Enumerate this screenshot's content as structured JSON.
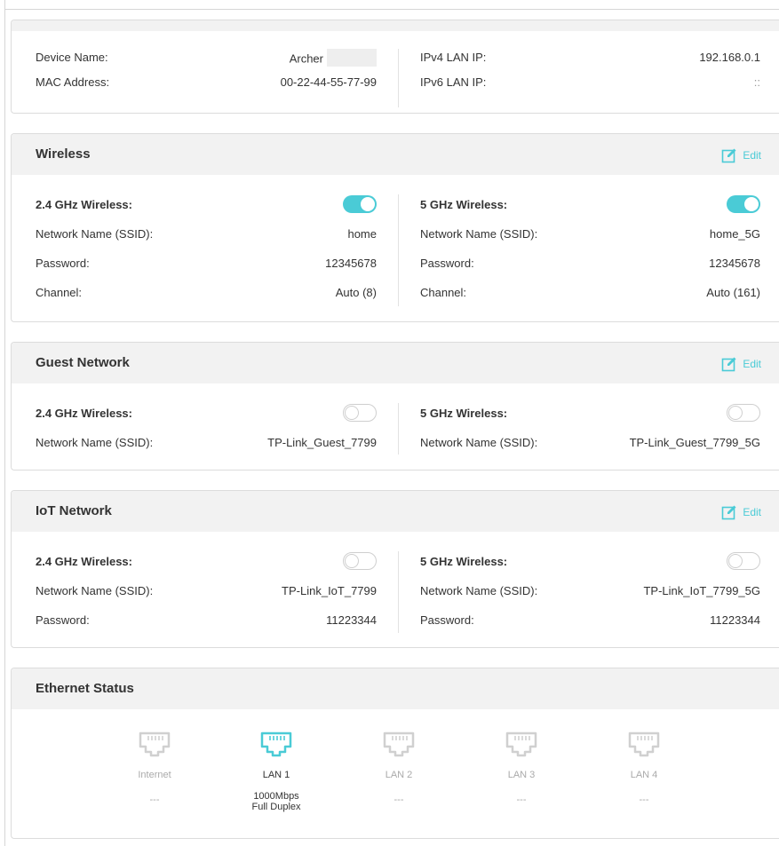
{
  "device": {
    "device_name_label": "Device Name:",
    "device_name_value": "Archer",
    "mac_label": "MAC Address:",
    "mac_value": "00-22-44-55-77-99",
    "ipv4_label": "IPv4 LAN IP:",
    "ipv4_value": "192.168.0.1",
    "ipv6_label": "IPv6 LAN IP:",
    "ipv6_value": "::"
  },
  "edit_label": "Edit",
  "wireless": {
    "title": "Wireless",
    "left": {
      "band_label": "2.4 GHz Wireless:",
      "enabled": true,
      "ssid_label": "Network Name (SSID):",
      "ssid_value": "home",
      "password_label": "Password:",
      "password_value": "12345678",
      "channel_label": "Channel:",
      "channel_value": "Auto (8)"
    },
    "right": {
      "band_label": "5 GHz Wireless:",
      "enabled": true,
      "ssid_label": "Network Name (SSID):",
      "ssid_value": "home_5G",
      "password_label": "Password:",
      "password_value": "12345678",
      "channel_label": "Channel:",
      "channel_value": "Auto (161)"
    }
  },
  "guest": {
    "title": "Guest Network",
    "left": {
      "band_label": "2.4 GHz Wireless:",
      "enabled": false,
      "ssid_label": "Network Name (SSID):",
      "ssid_value": "TP-Link_Guest_7799"
    },
    "right": {
      "band_label": "5 GHz Wireless:",
      "enabled": false,
      "ssid_label": "Network Name (SSID):",
      "ssid_value": "TP-Link_Guest_7799_5G"
    }
  },
  "iot": {
    "title": "IoT Network",
    "left": {
      "band_label": "2.4 GHz Wireless:",
      "enabled": false,
      "ssid_label": "Network Name (SSID):",
      "ssid_value": "TP-Link_IoT_7799",
      "password_label": "Password:",
      "password_value": "11223344"
    },
    "right": {
      "band_label": "5 GHz Wireless:",
      "enabled": false,
      "ssid_label": "Network Name (SSID):",
      "ssid_value": "TP-Link_IoT_7799_5G",
      "password_label": "Password:",
      "password_value": "11223344"
    }
  },
  "ethernet": {
    "title": "Ethernet Status",
    "ports": [
      {
        "name": "Internet",
        "status": "---",
        "active": false
      },
      {
        "name": "LAN 1",
        "status_line1": "1000Mbps",
        "status_line2": "Full Duplex",
        "active": true
      },
      {
        "name": "LAN 2",
        "status": "---",
        "active": false
      },
      {
        "name": "LAN 3",
        "status": "---",
        "active": false
      },
      {
        "name": "LAN 4",
        "status": "---",
        "active": false
      }
    ]
  },
  "colors": {
    "accent": "#4acbd6",
    "header_bg": "#f2f2f2",
    "inactive_port": "#d0d0d0"
  },
  "icons": {
    "edit": "edit-icon",
    "port": "ethernet-port-icon"
  }
}
